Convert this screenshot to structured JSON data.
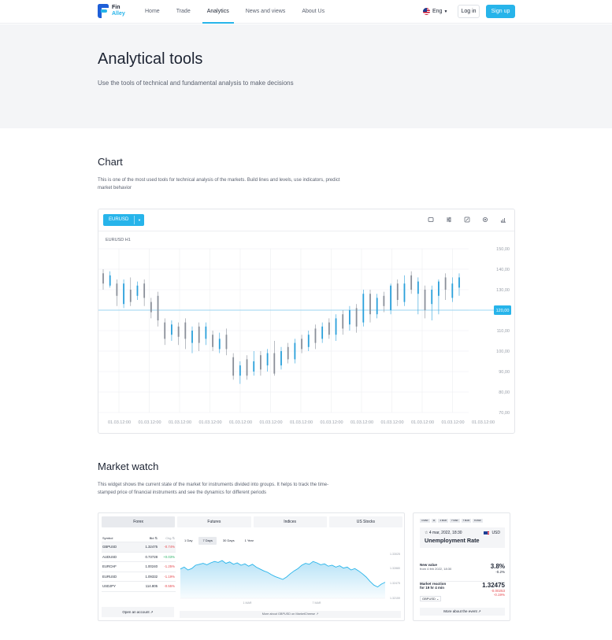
{
  "header": {
    "logo": {
      "line1": "Fin",
      "line2": "Alley"
    },
    "nav": [
      {
        "label": "Home",
        "active": false
      },
      {
        "label": "Trade",
        "active": false
      },
      {
        "label": "Analytics",
        "active": true
      },
      {
        "label": "News and views",
        "active": false
      },
      {
        "label": "About Us",
        "active": false
      }
    ],
    "language": "Eng",
    "login_label": "Log in",
    "signup_label": "Sign up"
  },
  "hero": {
    "title": "Analytical tools",
    "description": "Use the tools of technical and fundamental analysis to make decisions"
  },
  "chart_section": {
    "title": "Chart",
    "description": "This is one of the most used tools for technical analysis of the markets. Build lines and levels, use indicators, predict market behavior",
    "symbol": "EURUSD",
    "chart_label": "EURUSD H1",
    "tools": [
      "fullscreen-icon",
      "sliders-icon",
      "pencil-icon",
      "gear-icon",
      "bar-chart-icon"
    ]
  },
  "chart_data": {
    "type": "candlestick",
    "y_ticks": [
      "150,00",
      "140,00",
      "130,00",
      "120,00",
      "110,00",
      "100,00",
      "90,00",
      "80,00",
      "70,00"
    ],
    "ylim": [
      70,
      150
    ],
    "current_price": 120,
    "current_price_label": "120,00",
    "x_ticks": [
      "01.03.12:00",
      "01.03.12:00",
      "01.03.12:00",
      "01.03.12:00",
      "01.03.12:00",
      "01.03.12:00",
      "01.03.12:00",
      "01.03.12:00",
      "01.03.12:00",
      "01.03.12:00",
      "01.03.12:00",
      "01.03.12:00",
      "01.03.12:00"
    ],
    "colors": {
      "up": "#2aa0db",
      "down": "#8a8f99",
      "line": "#7ccbf0"
    },
    "candles": [
      {
        "o": 138,
        "c": 133,
        "h": 140,
        "l": 130
      },
      {
        "o": 132,
        "c": 137,
        "h": 139,
        "l": 131
      },
      {
        "o": 133,
        "c": 127,
        "h": 135,
        "l": 122
      },
      {
        "o": 123,
        "c": 133,
        "h": 135,
        "l": 121
      },
      {
        "o": 130,
        "c": 124,
        "h": 136,
        "l": 122
      },
      {
        "o": 127,
        "c": 132,
        "h": 134,
        "l": 125
      },
      {
        "o": 133,
        "c": 126,
        "h": 135,
        "l": 122
      },
      {
        "o": 124,
        "c": 119,
        "h": 126,
        "l": 116
      },
      {
        "o": 127,
        "c": 115,
        "h": 129,
        "l": 112
      },
      {
        "o": 114,
        "c": 106,
        "h": 116,
        "l": 103
      },
      {
        "o": 108,
        "c": 113,
        "h": 115,
        "l": 105
      },
      {
        "o": 112,
        "c": 107,
        "h": 114,
        "l": 103
      },
      {
        "o": 114,
        "c": 106,
        "h": 116,
        "l": 101
      },
      {
        "o": 104,
        "c": 110,
        "h": 112,
        "l": 99
      },
      {
        "o": 112,
        "c": 104,
        "h": 114,
        "l": 100
      },
      {
        "o": 106,
        "c": 112,
        "h": 114,
        "l": 103
      },
      {
        "o": 108,
        "c": 102,
        "h": 110,
        "l": 100
      },
      {
        "o": 101,
        "c": 106,
        "h": 109,
        "l": 99
      },
      {
        "o": 108,
        "c": 101,
        "h": 111,
        "l": 98
      },
      {
        "o": 97,
        "c": 88,
        "h": 99,
        "l": 86
      },
      {
        "o": 88,
        "c": 93,
        "h": 95,
        "l": 84
      },
      {
        "o": 96,
        "c": 88,
        "h": 98,
        "l": 86
      },
      {
        "o": 90,
        "c": 95,
        "h": 100,
        "l": 88
      },
      {
        "o": 98,
        "c": 91,
        "h": 100,
        "l": 88
      },
      {
        "o": 93,
        "c": 99,
        "h": 101,
        "l": 90
      },
      {
        "o": 99,
        "c": 89,
        "h": 105,
        "l": 88
      },
      {
        "o": 93,
        "c": 100,
        "h": 102,
        "l": 91
      },
      {
        "o": 102,
        "c": 96,
        "h": 104,
        "l": 94
      },
      {
        "o": 96,
        "c": 104,
        "h": 106,
        "l": 94
      },
      {
        "o": 106,
        "c": 101,
        "h": 108,
        "l": 99
      },
      {
        "o": 102,
        "c": 108,
        "h": 110,
        "l": 100
      },
      {
        "o": 111,
        "c": 104,
        "h": 113,
        "l": 101
      },
      {
        "o": 106,
        "c": 112,
        "h": 114,
        "l": 104
      },
      {
        "o": 114,
        "c": 108,
        "h": 116,
        "l": 106
      },
      {
        "o": 108,
        "c": 116,
        "h": 118,
        "l": 105
      },
      {
        "o": 118,
        "c": 111,
        "h": 120,
        "l": 108
      },
      {
        "o": 113,
        "c": 120,
        "h": 122,
        "l": 110
      },
      {
        "o": 121,
        "c": 112,
        "h": 123,
        "l": 109
      },
      {
        "o": 114,
        "c": 128,
        "h": 130,
        "l": 112
      },
      {
        "o": 128,
        "c": 118,
        "h": 130,
        "l": 114
      },
      {
        "o": 118,
        "c": 126,
        "h": 128,
        "l": 116
      },
      {
        "o": 127,
        "c": 122,
        "h": 129,
        "l": 119
      },
      {
        "o": 120,
        "c": 132,
        "h": 133,
        "l": 118
      },
      {
        "o": 133,
        "c": 125,
        "h": 135,
        "l": 122
      },
      {
        "o": 124,
        "c": 133,
        "h": 137,
        "l": 122
      },
      {
        "o": 137,
        "c": 130,
        "h": 139,
        "l": 128
      },
      {
        "o": 128,
        "c": 134,
        "h": 136,
        "l": 118
      },
      {
        "o": 130,
        "c": 120,
        "h": 132,
        "l": 116
      },
      {
        "o": 123,
        "c": 130,
        "h": 132,
        "l": 115
      },
      {
        "o": 127,
        "c": 134,
        "h": 135,
        "l": 118
      },
      {
        "o": 136,
        "c": 130,
        "h": 138,
        "l": 125
      },
      {
        "o": 126,
        "c": 133,
        "h": 136,
        "l": 124
      },
      {
        "o": 131,
        "c": 136,
        "h": 138,
        "l": 127
      }
    ]
  },
  "market_section": {
    "title": "Market watch",
    "description": "This widget shows the current state of the market for instruments divided into groups. It helps to track the time-stamped price of financial instruments and see the dynamics for different periods",
    "tabs": [
      "Forex",
      "Futures",
      "Indices",
      "US Stocks"
    ],
    "table_headers": {
      "symbol": "Symbol",
      "bid": "Bid",
      "chg": "Chg"
    },
    "rows": [
      {
        "symbol": "GBPUSD",
        "bid": "1.32475",
        "chg": "-0.74%",
        "dir": "neg"
      },
      {
        "symbol": "AUDUSD",
        "bid": "0.73728",
        "chg": "+0.03%",
        "dir": "pos"
      },
      {
        "symbol": "EURCHF",
        "bid": "1.00240",
        "chg": "-1.25%",
        "dir": "neg"
      },
      {
        "symbol": "EURUSD",
        "bid": "1.09332",
        "chg": "-1.19%",
        "dir": "neg"
      },
      {
        "symbol": "USDJPY",
        "bid": "114.805",
        "chg": "-0.55%",
        "dir": "neg"
      }
    ],
    "open_account_label": "Open an account",
    "periods": [
      "1 Day",
      "7 Days",
      "30 Days",
      "1 Year"
    ],
    "active_period": "7 Days",
    "mini_y_ticks": [
      "1.33025",
      "1.32880",
      "1.32475",
      "1.32159"
    ],
    "mini_x_ticks": [
      "1 MAR",
      "7 MAR"
    ],
    "more_link": "More about GBPUSD on MarketCheese"
  },
  "event_widget": {
    "chips": [
      "4 MAR",
      "11",
      "4 MAR",
      "7 MAR",
      "7 MAR",
      "8 MAR"
    ],
    "date": "4 mar, 2022, 18:30",
    "currency": "USD",
    "event_name": "Unemployment Rate",
    "new_value_label": "New value",
    "new_value_sub": "from 4 feb 2022, 18:30",
    "new_value": "3.8%",
    "new_value_change": "-0.2%",
    "reaction_label": "Market reaction",
    "reaction_sub": "for 19 hr 4 min",
    "reaction_pair": "GBPUSD",
    "reaction_value": "1.32475",
    "reaction_change": "-0.00253",
    "reaction_pct": "-0.19%",
    "more_label": "More about the event"
  }
}
